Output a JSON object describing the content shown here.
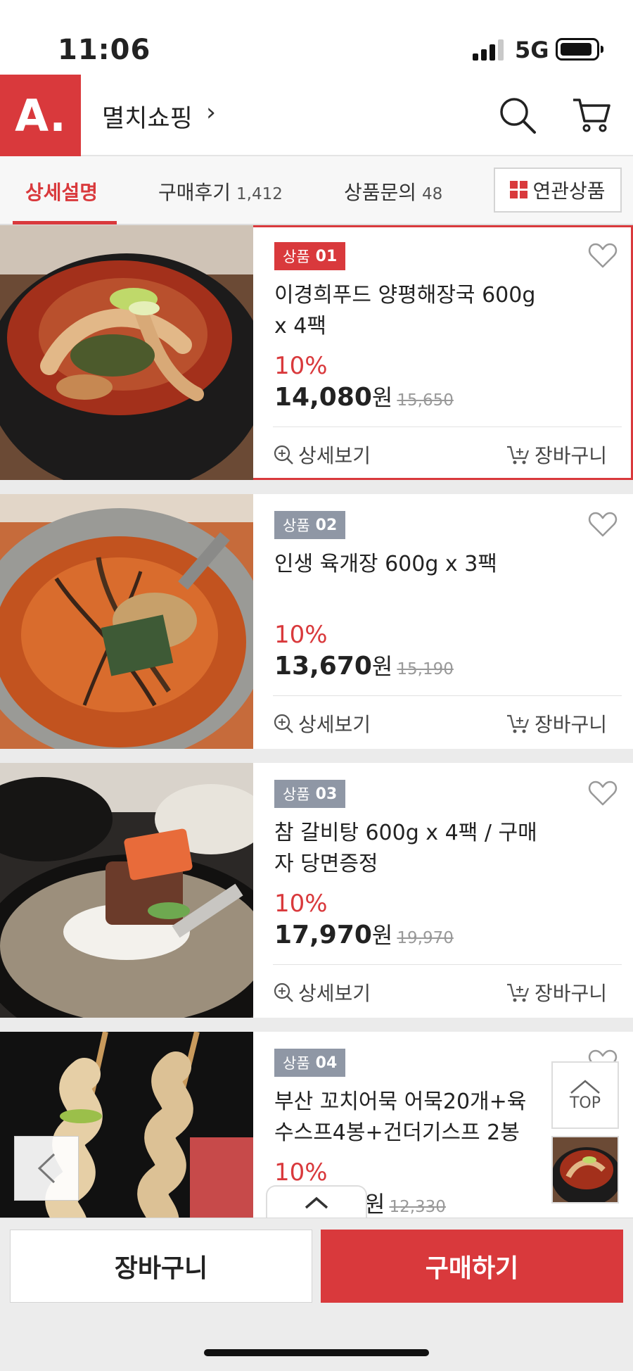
{
  "status_bar": {
    "time": "11:06",
    "network": "5G"
  },
  "header": {
    "logo": "A.",
    "shop_name": "멸치쇼핑",
    "chevron": "›"
  },
  "tabs": {
    "detail": {
      "label": "상세설명"
    },
    "reviews": {
      "label": "구매후기",
      "count": "1,412"
    },
    "qna": {
      "label": "상품문의",
      "count": "48"
    },
    "related": {
      "label": "연관상품"
    }
  },
  "products": [
    {
      "badge_label": "상품",
      "badge_num": "01",
      "title_line1": "이경희푸드 양평해장국 600g",
      "title_line2": "x 4팩",
      "discount": "10%",
      "price": "14,080",
      "unit": "원",
      "original_price": "15,650",
      "selected": true
    },
    {
      "badge_label": "상품",
      "badge_num": "02",
      "title_line1": "인생 육개장 600g x 3팩",
      "title_line2": "",
      "discount": "10%",
      "price": "13,670",
      "unit": "원",
      "original_price": "15,190",
      "selected": false
    },
    {
      "badge_label": "상품",
      "badge_num": "03",
      "title_line1": "참 갈비탕 600g x 4팩 / 구매",
      "title_line2": "자 당면증정",
      "discount": "10%",
      "price": "17,970",
      "unit": "원",
      "original_price": "19,970",
      "selected": false
    },
    {
      "badge_label": "상품",
      "badge_num": "04",
      "title_line1": "부산 꼬치어묵 어묵20개+육",
      "title_line2": "수스프4봉+건더기스프 2봉",
      "discount": "10%",
      "price": "",
      "unit": "원",
      "original_price": "12,330",
      "selected": false
    }
  ],
  "actions": {
    "detail": "상세보기",
    "cart": "장바구니"
  },
  "floating": {
    "top": "TOP"
  },
  "bottom_bar": {
    "cart": "장바구니",
    "buy": "구매하기"
  },
  "colors": {
    "accent": "#d9393c",
    "badge_gray": "#8f97a5"
  }
}
